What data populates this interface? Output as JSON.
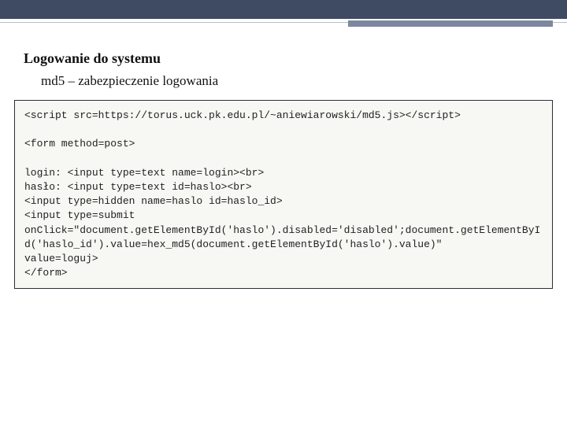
{
  "header": {
    "title": "Logowanie do systemu",
    "subtitle": "md5 – zabezpieczenie logowania"
  },
  "code": {
    "line1": "<script src=https://torus.uck.pk.edu.pl/~aniewiarowski/md5.js></script>",
    "blank1": "",
    "line2": "<form method=post>",
    "blank2": "",
    "line3": "login: <input type=text name=login><br>",
    "line4": "hasło: <input type=text id=haslo><br>",
    "line5": "<input type=hidden name=haslo id=haslo_id>",
    "line6": "<input type=submit",
    "line7": "onClick=\"document.getElementById('haslo').disabled='disabled';document.getElementById('haslo_id').value=hex_md5(document.getElementById('haslo').value)\"",
    "line8": "value=loguj>",
    "line9": "</form>"
  }
}
